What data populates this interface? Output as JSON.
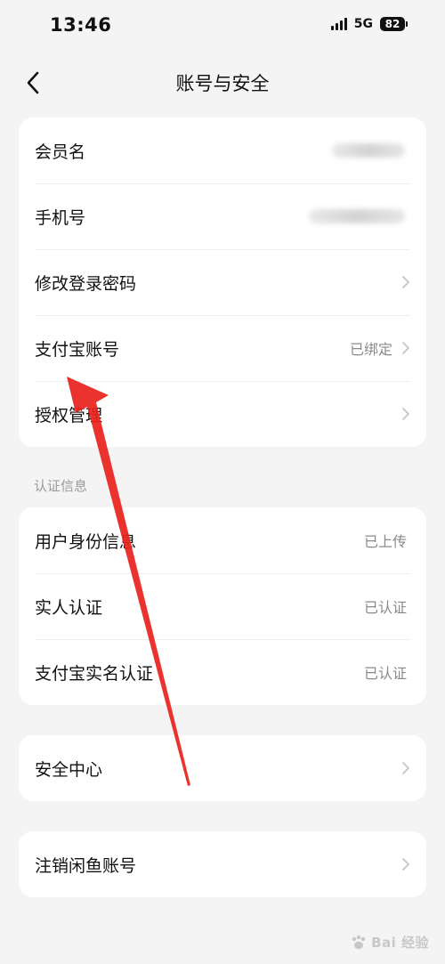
{
  "status_bar": {
    "time": "13:46",
    "network": "5G",
    "battery": "82"
  },
  "nav": {
    "title": "账号与安全"
  },
  "account_card": {
    "items": [
      {
        "label": "会员名",
        "value": ""
      },
      {
        "label": "手机号",
        "value": ""
      },
      {
        "label": "修改登录密码",
        "value": ""
      },
      {
        "label": "支付宝账号",
        "value": "已绑定"
      },
      {
        "label": "授权管理",
        "value": ""
      }
    ]
  },
  "verification_section": {
    "header": "认证信息",
    "items": [
      {
        "label": "用户身份信息",
        "value": "已上传"
      },
      {
        "label": "实人认证",
        "value": "已认证"
      },
      {
        "label": "支付宝实名认证",
        "value": "已认证"
      }
    ]
  },
  "security_center": {
    "label": "安全中心"
  },
  "close_account": {
    "label": "注销闲鱼账号"
  },
  "annotation": {
    "color": "#e8231f"
  },
  "watermark": {
    "text": "Bai 经验"
  }
}
